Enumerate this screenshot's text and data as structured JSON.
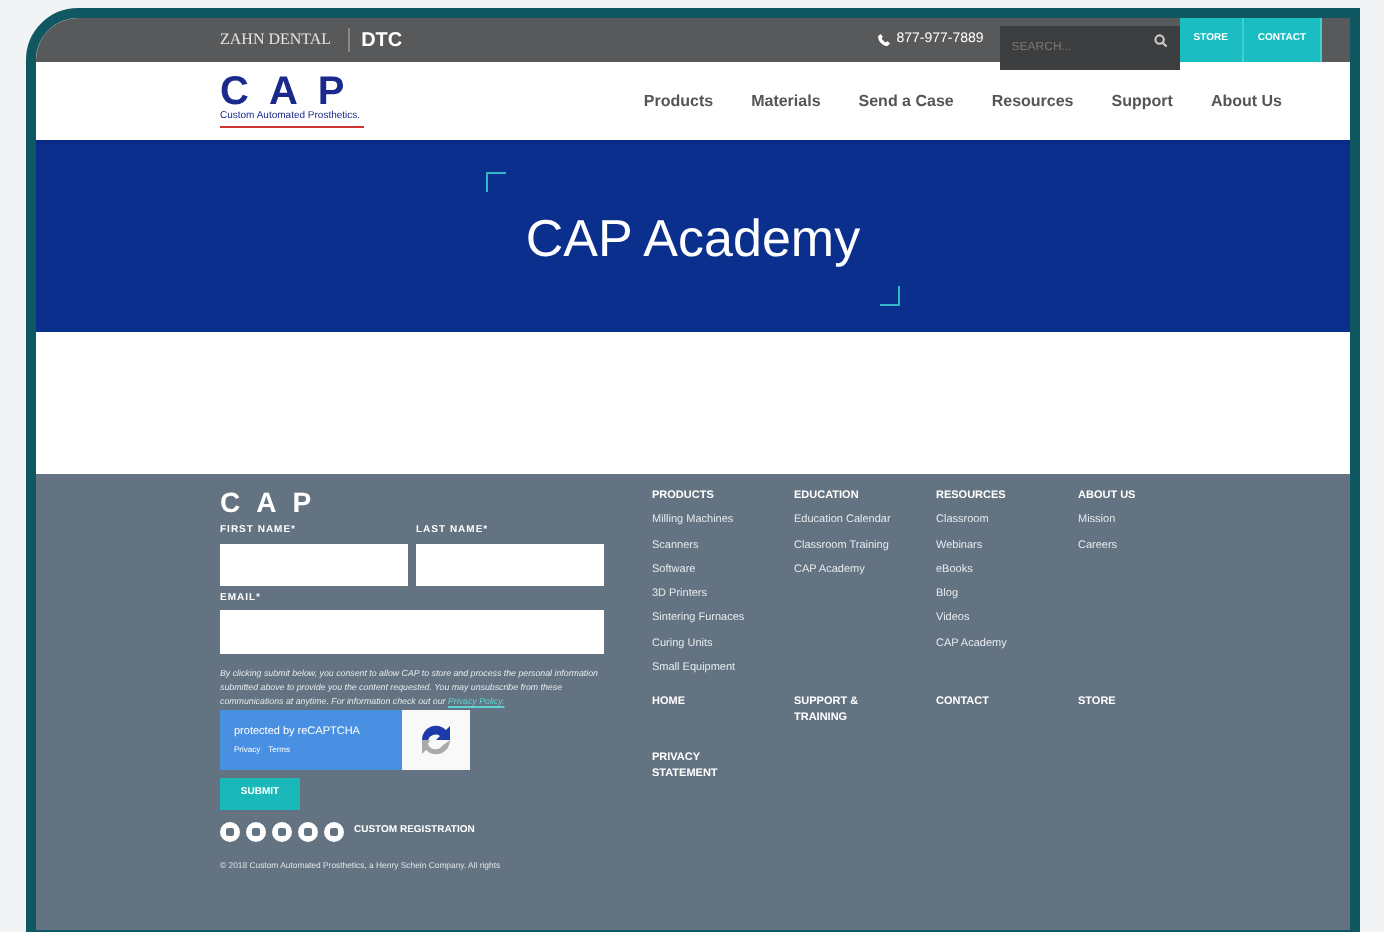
{
  "topbar": {
    "logos": [
      "ZAHN DENTAL",
      "DTC"
    ],
    "phone": "877-977-7889",
    "search": {
      "placeholder": "SEARCH..."
    },
    "buttons": [
      "STORE",
      "CONTACT"
    ]
  },
  "header": {
    "logo": {
      "mark": "CAP",
      "tagline": "Custom Automated Prosthetics."
    },
    "nav": [
      "Products",
      "Materials",
      "Send a Case",
      "Resources",
      "Support",
      "About Us"
    ]
  },
  "banner": {
    "title": "CAP Academy"
  },
  "footer": {
    "logo": "CAP",
    "fields": [
      {
        "label": "FIRST NAME*"
      },
      {
        "label": "LAST NAME*"
      },
      {
        "label": "EMAIL*"
      }
    ],
    "consent": {
      "text": "By clicking submit below, you consent to allow CAP to store and process the personal information submitted above to provide you the content requested. You may unsubscribe from these communications at anytime. For information check out our ",
      "link": "Privacy Policy."
    },
    "recaptcha": {
      "title": "protected by reCAPTCHA",
      "links": [
        "Privacy",
        "Terms"
      ]
    },
    "submit": "SUBMIT",
    "custom_registration": "CUSTOM REGISTRATION",
    "columns": [
      {
        "heading": "PRODUCTS",
        "links": [
          "Milling Machines",
          "Scanners",
          "Software",
          "3D Printers",
          "Sintering Furnaces",
          "Curing Units",
          "Small Equipment"
        ]
      },
      {
        "heading": "EDUCATION",
        "links": [
          "Education Calendar",
          "Classroom Training",
          "CAP Academy"
        ]
      },
      {
        "heading": "RESOURCES",
        "links": [
          "Classroom",
          "Webinars",
          "eBooks",
          "Blog",
          "Videos",
          "CAP Academy"
        ]
      },
      {
        "heading": "ABOUT US",
        "links": [
          "Mission",
          "Careers"
        ]
      }
    ],
    "bottom_links": [
      "HOME",
      "SUPPORT & TRAINING",
      "CONTACT",
      "STORE",
      "PRIVACY STATEMENT"
    ],
    "copyright": "© 2018 Custom Automated Prosthetics, a Henry Schein Company. All rights"
  }
}
